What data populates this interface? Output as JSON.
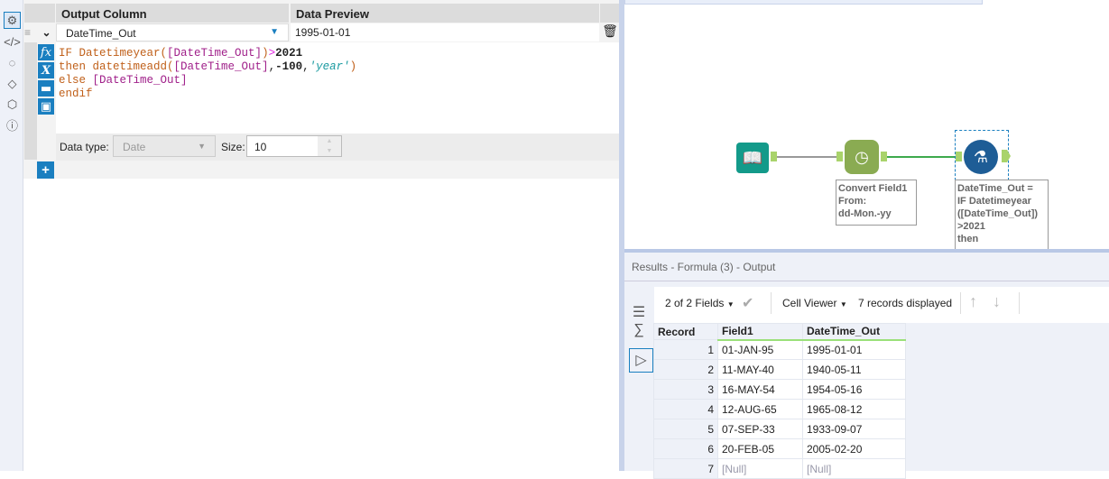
{
  "sidebar": {
    "icons": [
      "gear-icon",
      "code-icon",
      "arrow-circle-icon",
      "tag-icon",
      "cube-icon",
      "help-icon"
    ]
  },
  "config": {
    "header_output": "Output Column",
    "header_preview": "Data Preview",
    "field_name": "DateTime_Out",
    "preview_value": "1995-01-01",
    "code": {
      "l1a": "IF Datetimeyear(",
      "l1b": "[DateTime_Out]",
      "l1c": ")",
      "l1d": ">",
      "l1e": "2021",
      "l2a": "then datetimeadd(",
      "l2b": "[DateTime_Out]",
      "l2c": ",",
      "l2d": "-100",
      ",": ",",
      "l2e": "'year'",
      "l2f": ")",
      "l3a": "else ",
      "l3b": "[DateTime_Out]",
      "l4": "endif"
    },
    "fx_label": "fx",
    "x_label": "X",
    "data_type_label": "Data type:",
    "data_type_value": "Date",
    "size_label": "Size:",
    "size_value": "10",
    "add_label": "+"
  },
  "canvas": {
    "tool1_annotation": "Convert Field1\nFrom:\ndd-Mon.-yy",
    "tool2_annotation": "DateTime_Out =\nIF Datetimeyear\n([DateTime_Out])\n>2021\nthen"
  },
  "results": {
    "title": "Results - Formula (3) - Output",
    "fields_label": "2 of 2 Fields",
    "viewer_label": "Cell Viewer",
    "records_label": "7 records displayed",
    "columns": [
      "Record",
      "Field1",
      "DateTime_Out"
    ],
    "rows": [
      [
        "1",
        "01-JAN-95",
        "1995-01-01"
      ],
      [
        "2",
        "11-MAY-40",
        "1940-05-11"
      ],
      [
        "3",
        "16-MAY-54",
        "1954-05-16"
      ],
      [
        "4",
        "12-AUG-65",
        "1965-08-12"
      ],
      [
        "5",
        "07-SEP-33",
        "1933-09-07"
      ],
      [
        "6",
        "20-FEB-05",
        "2005-02-20"
      ],
      [
        "7",
        "[Null]",
        "[Null]"
      ]
    ]
  },
  "colors": {
    "accent": "#1a7fc0",
    "keyword": "#c0601a",
    "field": "#a0208a",
    "string": "#1a9aa0"
  }
}
